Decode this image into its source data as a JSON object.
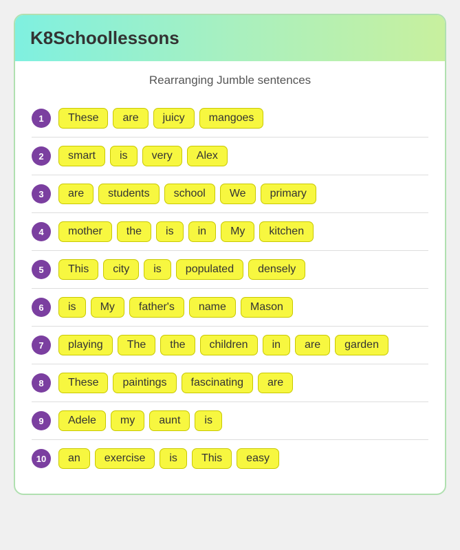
{
  "header": {
    "title": "K8Schoollessons"
  },
  "page": {
    "subtitle": "Rearranging Jumble sentences"
  },
  "sentences": [
    {
      "id": 1,
      "words": [
        "These",
        "are",
        "juicy",
        "mangoes"
      ]
    },
    {
      "id": 2,
      "words": [
        "smart",
        "is",
        "very",
        "Alex"
      ]
    },
    {
      "id": 3,
      "words": [
        "are",
        "students",
        "school",
        "We",
        "primary"
      ]
    },
    {
      "id": 4,
      "words": [
        "mother",
        "the",
        "is",
        "in",
        "My",
        "kitchen"
      ]
    },
    {
      "id": 5,
      "words": [
        "This",
        "city",
        "is",
        "populated",
        "densely"
      ]
    },
    {
      "id": 6,
      "words": [
        "is",
        "My",
        "father's",
        "name",
        "Mason"
      ]
    },
    {
      "id": 7,
      "words": [
        "playing",
        "The",
        "the",
        "children",
        "in",
        "are",
        "garden"
      ]
    },
    {
      "id": 8,
      "words": [
        "These",
        "paintings",
        "fascinating",
        "are"
      ]
    },
    {
      "id": 9,
      "words": [
        "Adele",
        "my",
        "aunt",
        "is"
      ]
    },
    {
      "id": 10,
      "words": [
        "an",
        "exercise",
        "is",
        "This",
        "easy"
      ]
    }
  ]
}
